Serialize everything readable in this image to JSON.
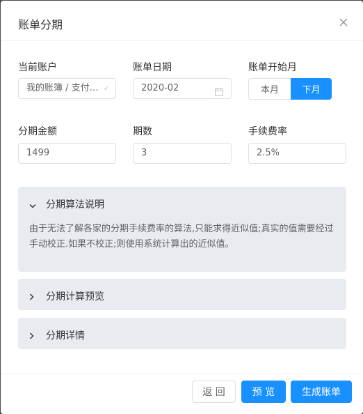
{
  "dialog": {
    "title": "账单分期",
    "close_icon": "close-icon"
  },
  "form": {
    "account": {
      "label": "当前账户",
      "value": "我的账簿 / 支付…"
    },
    "bill_date": {
      "label": "账单日期",
      "value": "2020-02"
    },
    "start_month": {
      "label": "账单开始月",
      "options": [
        "本月",
        "下月"
      ],
      "selected": "下月"
    },
    "amount": {
      "label": "分期金额",
      "value": "1499"
    },
    "periods": {
      "label": "期数",
      "value": "3"
    },
    "fee_rate": {
      "label": "手续费率",
      "value": "2.5%"
    }
  },
  "panels": [
    {
      "title": "分期算法说明",
      "expanded": true,
      "body": "由于无法了解各家的分期手续费率的算法,只能求得近似值;真实的值需要经过手动校正.如果不校正;则使用系统计算出的近似值。"
    },
    {
      "title": "分期计算预览",
      "expanded": false
    },
    {
      "title": "分期详情",
      "expanded": false
    }
  ],
  "footer": {
    "back": "返 回",
    "preview": "预 览",
    "generate": "生成账单"
  },
  "colors": {
    "primary": "#1890ff",
    "panel_bg": "#e8ebf0"
  }
}
